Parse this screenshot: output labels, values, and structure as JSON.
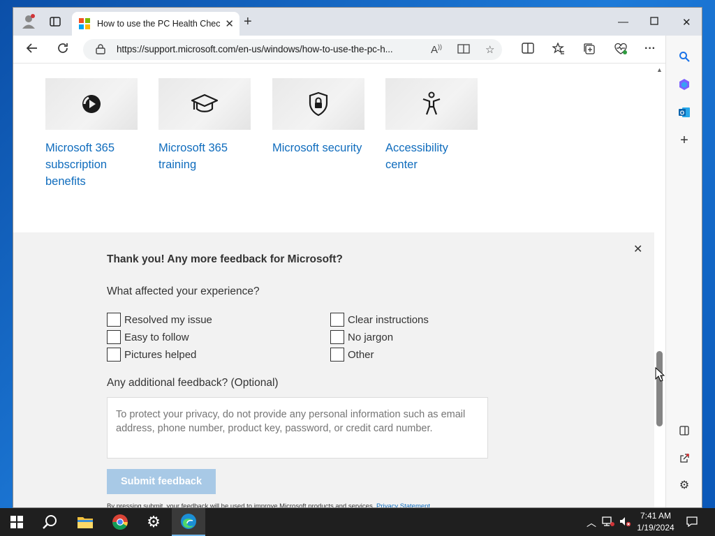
{
  "browser": {
    "tab_title": "How to use the PC Health Check",
    "url": "https://support.microsoft.com/en-us/windows/how-to-use-the-pc-h...",
    "favicon_colors": [
      "#f25022",
      "#7fba00",
      "#00a4ef",
      "#ffb900"
    ]
  },
  "cards": [
    {
      "label_line1": "Microsoft 365",
      "label_line2": "subscription",
      "label_line3": "benefits",
      "icon": "microsoft365-icon"
    },
    {
      "label_line1": "Microsoft 365",
      "label_line2": "training",
      "icon": "graduation-cap-icon"
    },
    {
      "label_line1": "Microsoft security",
      "icon": "shield-lock-icon"
    },
    {
      "label_line1": "Accessibility",
      "label_line2": "center",
      "icon": "accessibility-icon"
    }
  ],
  "feedback": {
    "title": "Thank you! Any more feedback for Microsoft?",
    "question": "What affected your experience?",
    "options_left": [
      "Resolved my issue",
      "Easy to follow",
      "Pictures helped"
    ],
    "options_right": [
      "Clear instructions",
      "No jargon",
      "Other"
    ],
    "additional_label": "Any additional feedback? (Optional)",
    "textarea_placeholder": "To protect your privacy, do not provide any personal information such as email address, phone number, product key, password, or credit card number.",
    "submit_label": "Submit feedback",
    "fine_print": "By pressing submit, your feedback will be used to improve Microsoft products and services. ",
    "privacy_link": "Privacy Statement."
  },
  "taskbar": {
    "time": "7:41 AM",
    "date": "1/19/2024"
  },
  "colors": {
    "link": "#0f6cbd",
    "submit_disabled": "#a8c9e6",
    "feedback_bg": "#f2f2f2"
  }
}
